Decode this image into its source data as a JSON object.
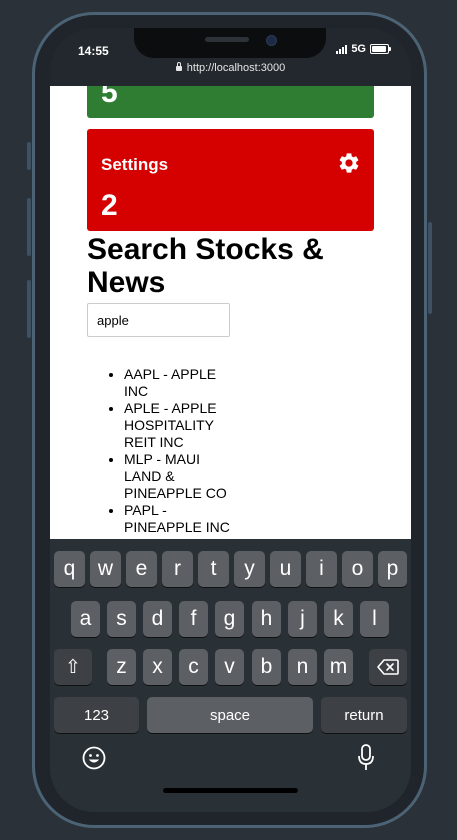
{
  "status_bar": {
    "time": "14:55",
    "network": "5G"
  },
  "browser": {
    "url": "http://localhost:3000"
  },
  "cards": [
    {
      "count": "5",
      "color": "#2e7d32"
    },
    {
      "title": "Settings",
      "count": "2",
      "color": "#d50000",
      "icon": "gear-icon"
    }
  ],
  "search": {
    "heading": "Search Stocks & News",
    "value": "apple",
    "results": [
      "AAPL - APPLE INC",
      "APLE - APPLE HOSPITALITY REIT INC",
      "MLP - MAUI LAND & PINEAPPLE CO",
      "PAPL - PINEAPPLE INC"
    ]
  },
  "keyboard": {
    "row1": [
      "q",
      "w",
      "e",
      "r",
      "t",
      "y",
      "u",
      "i",
      "o",
      "p"
    ],
    "row2": [
      "a",
      "s",
      "d",
      "f",
      "g",
      "h",
      "j",
      "k",
      "l"
    ],
    "row3": [
      "z",
      "x",
      "c",
      "v",
      "b",
      "n",
      "m"
    ],
    "shift": "⇧",
    "numbers": "123",
    "space": "space",
    "return": "return"
  }
}
